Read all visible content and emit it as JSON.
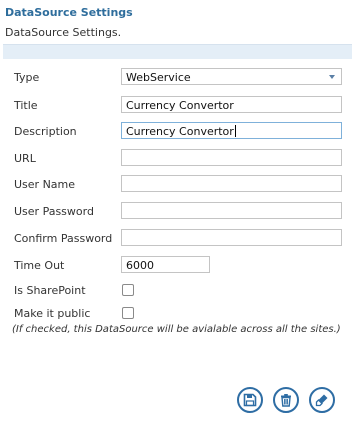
{
  "panel": {
    "title": "DataSource Settings",
    "description": "DataSource Settings."
  },
  "form": {
    "type": {
      "label": "Type",
      "value": "WebService"
    },
    "title": {
      "label": "Title",
      "value": "Currency Convertor"
    },
    "description": {
      "label": "Description",
      "value": "Currency Convertor"
    },
    "url": {
      "label": "URL",
      "value": ""
    },
    "user_name": {
      "label": "User Name",
      "value": ""
    },
    "user_password": {
      "label": "User Password",
      "value": ""
    },
    "confirm_password": {
      "label": "Confirm Password",
      "value": ""
    },
    "time_out": {
      "label": "Time Out",
      "value": "6000"
    },
    "is_sharepoint": {
      "label": "Is SharePoint",
      "checked": false
    },
    "make_public": {
      "label": "Make it public",
      "checked": false
    },
    "public_note": "(If checked, this DataSource will be avialable across all the sites.)"
  },
  "actions": {
    "save_icon": "floppy-disk-icon",
    "delete_icon": "trash-icon",
    "clear_icon": "eraser-icon"
  },
  "colors": {
    "accent": "#2e6da4",
    "title": "#2e6d9c",
    "bar": "#e4eef7"
  }
}
